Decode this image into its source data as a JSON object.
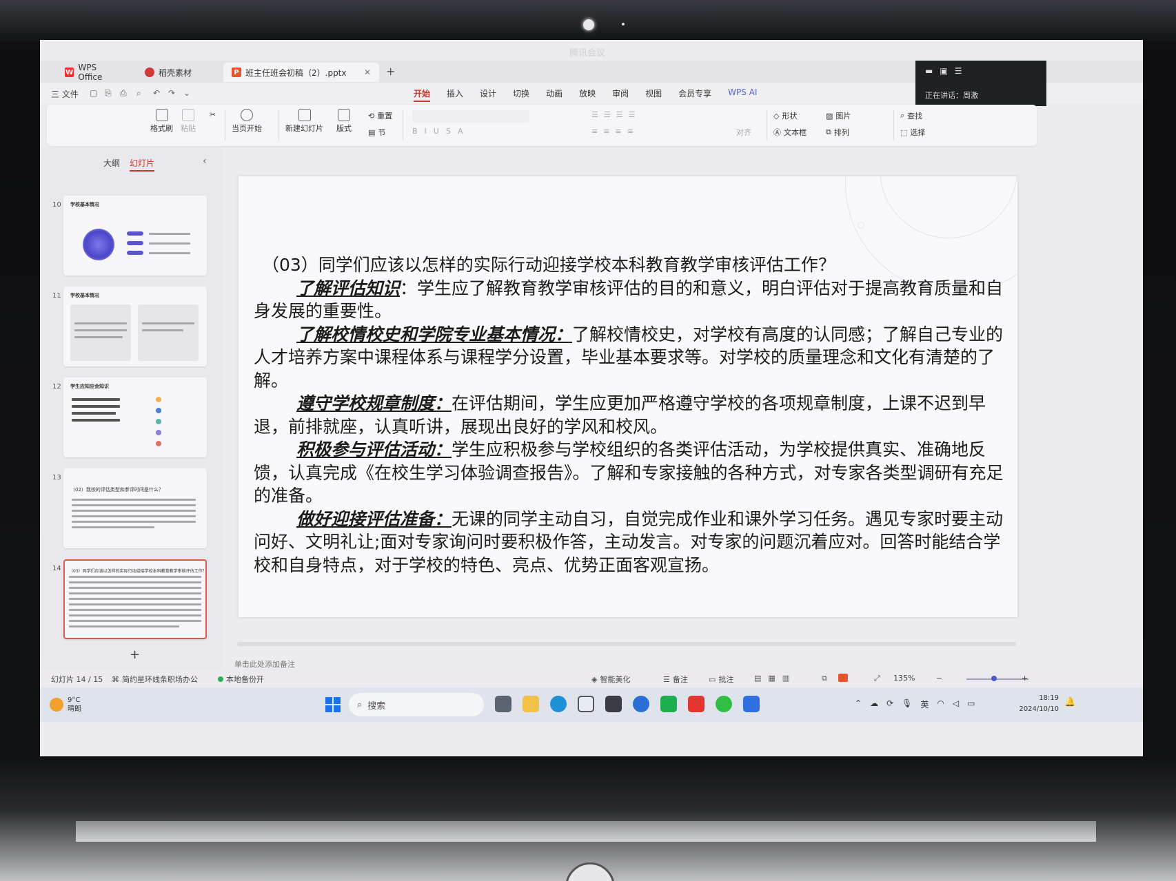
{
  "window": {
    "meeting_title": "腾讯会议"
  },
  "tabs": [
    {
      "label": "WPS Office"
    },
    {
      "label": "稻壳素材"
    },
    {
      "label": "班主任班会初稿（2）.pptx"
    }
  ],
  "menu": {
    "file": "三 文件",
    "tabs": [
      "开始",
      "插入",
      "设计",
      "切换",
      "动画",
      "放映",
      "审阅",
      "视图",
      "会员专享",
      "WPS AI"
    ]
  },
  "meeting_panel": {
    "speaking": "正在讲话：周激"
  },
  "ribbon": {
    "format_painter": "格式刷",
    "paste": "粘贴",
    "play_current": "当页开始",
    "new_slide": "新建幻灯片",
    "layout": "版式",
    "reset": "重置",
    "section": "节",
    "align": "对齐",
    "shape": "形状",
    "picture": "图片",
    "textbox": "文本框",
    "arrange": "排列",
    "find": "查找",
    "select": "选择"
  },
  "side_panel": {
    "tabs": [
      "大纲",
      "幻灯片"
    ],
    "thumbnails": [
      {
        "num": "10",
        "title": "学校基本情况"
      },
      {
        "num": "11",
        "title": "学校基本情况"
      },
      {
        "num": "12",
        "title": "学生应知应会知识"
      },
      {
        "num": "13",
        "title": "（02）我校的评估类型和参评时间是什么？"
      },
      {
        "num": "14",
        "title": "（03）同学们应该以怎样的实际行动迎接学校本科教育教学审核评估工作？"
      }
    ]
  },
  "slide": {
    "title": "（03）同学们应该以怎样的实际行动迎接学校本科教育教学审核评估工作？",
    "paragraphs": [
      {
        "keyword": "了解评估知识",
        "text": "：学生应了解教育教学审核评估的目的和意义，明白评估对于提高教育质量和自身发展的重要性。"
      },
      {
        "keyword": "了解校情校史和学院专业基本情况：",
        "text": "了解校情校史，对学校有高度的认同感；了解自己专业的人才培养方案中课程体系与课程学分设置，毕业基本要求等。对学校的质量理念和文化有清楚的了解。"
      },
      {
        "keyword": "遵守学校规章制度：",
        "text": "在评估期间，学生应更加严格遵守学校的各项规章制度，上课不迟到早退，前排就座，认真听讲，展现出良好的学风和校风。"
      },
      {
        "keyword": "积极参与评估活动：",
        "text": "学生应积极参与学校组织的各类评估活动，为学校提供真实、准确地反馈，认真完成《在校生学习体验调查报告》。了解和专家接触的各种方式，对专家各类型调研有充足的准备。"
      },
      {
        "keyword": "做好迎接评估准备：",
        "text": "无课的同学主动自习，自觉完成作业和课外学习任务。遇见专家时要主动问好、文明礼让;面对专家询问时要积极作答，主动发言。对专家的问题沉着应对。回答时能结合学校和自身特点，对于学校的特色、亮点、优势正面客观宣扬。"
      }
    ]
  },
  "notes_placeholder": "单击此处添加备注",
  "status": {
    "slide_counter": "幻灯片 14 / 15",
    "theme": "简约星环线条职场办公",
    "backup": "本地备份开",
    "beautify": "智能美化",
    "notes": "备注",
    "comments": "批注",
    "zoom": "135%"
  },
  "taskbar": {
    "temp": "9°C",
    "weather": "晴朗",
    "search": "搜索",
    "lang": "英",
    "time": "18:19",
    "date": "2024/10/10"
  },
  "colors": {
    "accent": "#c0392b",
    "selection": "#d95a4a",
    "ai": "#5561d6"
  }
}
